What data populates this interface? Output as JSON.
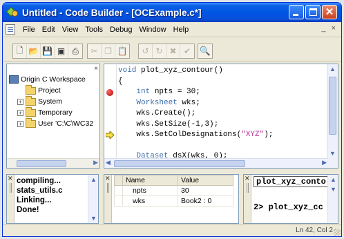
{
  "window": {
    "title": "Untitled - Code Builder - [OCExample.c*]"
  },
  "menubar": {
    "items": [
      "File",
      "Edit",
      "View",
      "Tools",
      "Debug",
      "Window",
      "Help"
    ],
    "mdi_controls": [
      "_",
      "×"
    ]
  },
  "toolbar": {
    "groups": [
      [
        "new-icon",
        "open-icon",
        "save-icon",
        "save-all-icon",
        "print-icon"
      ],
      [
        "cut-icon",
        "copy-icon",
        "paste-icon"
      ],
      [
        "undo-icon",
        "redo-icon",
        "delete-icon",
        "check-icon"
      ],
      [
        "find-icon"
      ]
    ]
  },
  "workspace": {
    "header_close": "×",
    "root": "Origin C Workspace",
    "items": [
      {
        "label": "Project",
        "expandable": false
      },
      {
        "label": "System",
        "expandable": true
      },
      {
        "label": "Temporary",
        "expandable": true
      },
      {
        "label": "User 'C:\\C\\WC32",
        "expandable": true
      }
    ]
  },
  "editor": {
    "lines": [
      "void plot_xyz_contour()",
      "{",
      "    int npts = 30;",
      "    Worksheet wks;",
      "    wks.Create();",
      "    wks.SetSize(-1,3);",
      "    wks.SetColDesignations(\"XYZ\");",
      "",
      "    Dataset dsX(wks, 0);"
    ],
    "breakpoint_line": 3,
    "current_line": 7
  },
  "output": {
    "lines": [
      "compiling...",
      "stats_utils.c",
      "Linking...",
      "Done!"
    ]
  },
  "variables": {
    "columns": [
      "Name",
      "Value"
    ],
    "rows": [
      {
        "name": "npts",
        "value": "30"
      },
      {
        "name": "wks",
        "value": "Book2 : 0"
      }
    ]
  },
  "callstack": {
    "lines": [
      "plot_xyz_conto",
      "2> plot_xyz_cc"
    ]
  },
  "status": {
    "position": "Ln 42, Col 2"
  }
}
